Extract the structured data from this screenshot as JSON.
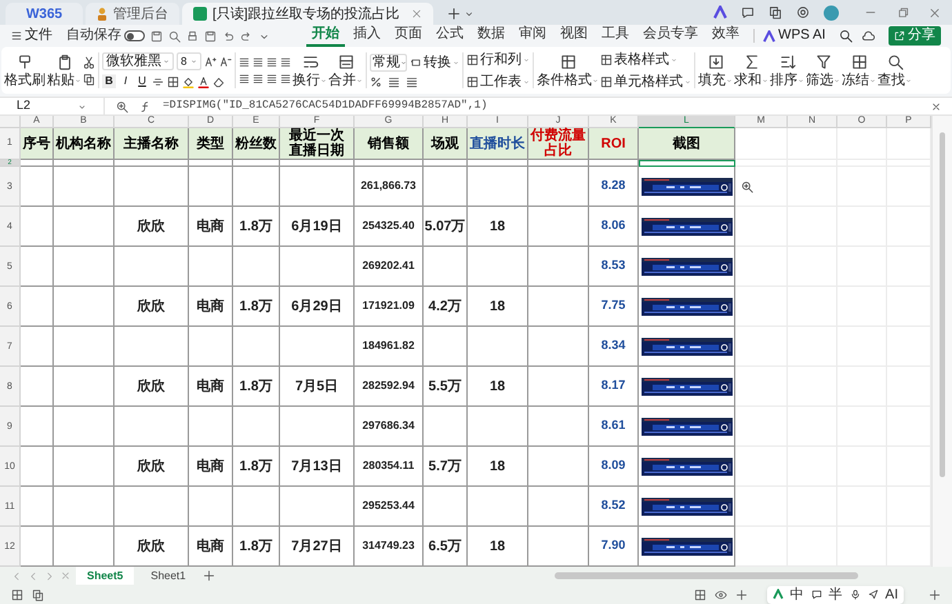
{
  "app_logo": "W365",
  "browser_tabs": [
    {
      "label": "管理后台",
      "selected": false
    },
    {
      "label": "[只读]跟拉丝取专场的投流占比",
      "selected": true
    }
  ],
  "menu": {
    "file": "文件",
    "autosave": {
      "label": "自动保存",
      "on": false
    },
    "tabs": [
      {
        "label": "开始",
        "selected": true
      },
      {
        "label": "插入",
        "selected": false
      },
      {
        "label": "页面",
        "selected": false
      },
      {
        "label": "公式",
        "selected": false
      },
      {
        "label": "数据",
        "selected": false
      },
      {
        "label": "审阅",
        "selected": false
      },
      {
        "label": "视图",
        "selected": false
      },
      {
        "label": "工具",
        "selected": false
      },
      {
        "label": "会员专享",
        "selected": false
      },
      {
        "label": "效率",
        "selected": false
      }
    ],
    "ai": "WPS AI",
    "share": "分享"
  },
  "ribbon": {
    "clipboard": [
      "格式刷",
      "粘贴"
    ],
    "font": {
      "name": "微软雅黑",
      "size": "8",
      "styles": [
        "B",
        "I",
        "U"
      ]
    },
    "align": [
      "换行",
      "合并"
    ],
    "number": {
      "format": "常规",
      "convert": "转换"
    },
    "sheet": [
      "行和列",
      "工作表"
    ],
    "styles": [
      "条件格式",
      "表格样式",
      "单元格样式"
    ],
    "edit": [
      "填充",
      "求和",
      "排序",
      "筛选",
      "冻结",
      "查找"
    ]
  },
  "formula_bar": {
    "cell": "L2",
    "formula": "=DISPIMG(\"ID_81CA5276CAC54D1DADFF69994B2857AD\",1)"
  },
  "columns": [
    {
      "label": "A",
      "selected": false
    },
    {
      "label": "B",
      "selected": false
    },
    {
      "label": "C",
      "selected": false
    },
    {
      "label": "D",
      "selected": false
    },
    {
      "label": "E",
      "selected": false
    },
    {
      "label": "F",
      "selected": false
    },
    {
      "label": "G",
      "selected": false
    },
    {
      "label": "H",
      "selected": false
    },
    {
      "label": "I",
      "selected": false
    },
    {
      "label": "J",
      "selected": false
    },
    {
      "label": "K",
      "selected": false
    },
    {
      "label": "L",
      "selected": true
    },
    {
      "label": "M",
      "selected": false
    },
    {
      "label": "N",
      "selected": false
    },
    {
      "label": "O",
      "selected": false
    },
    {
      "label": "P",
      "selected": false
    }
  ],
  "header": {
    "number": "1",
    "cells": [
      {
        "label": "序号",
        "color": "#000000"
      },
      {
        "label": "机构名称",
        "color": "#000000"
      },
      {
        "label": "主播名称",
        "color": "#000000"
      },
      {
        "label": "类型",
        "color": "#000000"
      },
      {
        "label": "粉丝数",
        "color": "#000000"
      },
      {
        "label": "最近一次直播日期",
        "color": "#000000"
      },
      {
        "label": "销售额",
        "color": "#000000"
      },
      {
        "label": "场观",
        "color": "#000000"
      },
      {
        "label": "直播时长",
        "color": "#1f4e9c"
      },
      {
        "label": "付费流量占比",
        "color": "#d00000"
      },
      {
        "label": "ROI",
        "color": "#d00000"
      },
      {
        "label": "截图",
        "color": "#000000"
      }
    ]
  },
  "rows": [
    {
      "number": "2",
      "selected": true
    },
    {
      "number": "3",
      "selected": false,
      "sales": "261,866.73",
      "roi": "8.28"
    },
    {
      "number": "4",
      "selected": false,
      "anchor": "欣欣",
      "type": "电商",
      "fans": "1.8万",
      "date": "6月19日",
      "sales": "254325.40",
      "views": "5.07万",
      "duration": "18",
      "roi": "8.06"
    },
    {
      "number": "5",
      "selected": false,
      "sales": "269202.41",
      "roi": "8.53"
    },
    {
      "number": "6",
      "selected": false,
      "anchor": "欣欣",
      "type": "电商",
      "fans": "1.8万",
      "date": "6月29日",
      "sales": "171921.09",
      "views": "4.2万",
      "duration": "18",
      "roi": "7.75"
    },
    {
      "number": "7",
      "selected": false,
      "sales": "184961.82",
      "roi": "8.34"
    },
    {
      "number": "8",
      "selected": false,
      "anchor": "欣欣",
      "type": "电商",
      "fans": "1.8万",
      "date": "7月5日",
      "sales": "282592.94",
      "views": "5.5万",
      "duration": "18",
      "roi": "8.17"
    },
    {
      "number": "9",
      "selected": false,
      "sales": "297686.34",
      "roi": "8.61"
    },
    {
      "number": "10",
      "selected": false,
      "anchor": "欣欣",
      "type": "电商",
      "fans": "1.8万",
      "date": "7月13日",
      "sales": "280354.11",
      "views": "5.7万",
      "duration": "18",
      "roi": "8.09"
    },
    {
      "number": "11",
      "selected": false,
      "sales": "295253.44",
      "roi": "8.52"
    },
    {
      "number": "12",
      "selected": false,
      "anchor": "欣欣",
      "type": "电商",
      "fans": "1.8万",
      "date": "7月27日",
      "sales": "314749.23",
      "views": "6.5万",
      "duration": "18",
      "roi": "7.90"
    }
  ],
  "sheet_tabs": [
    {
      "label": "Sheet5",
      "selected": true
    },
    {
      "label": "Sheet1",
      "selected": false
    }
  ],
  "ime": [
    "中",
    "半",
    "AI"
  ]
}
